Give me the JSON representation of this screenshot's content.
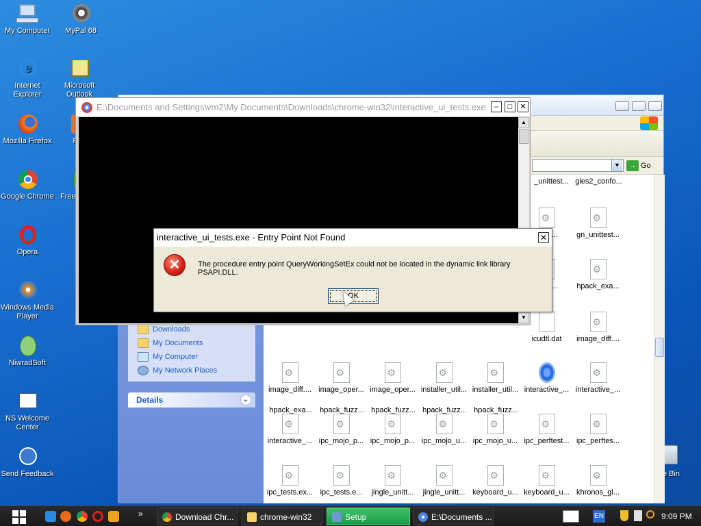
{
  "desktop": {
    "icons": [
      {
        "label": "My Computer"
      },
      {
        "label": "MyPal 68"
      },
      {
        "label": "Internet Explorer"
      },
      {
        "label": "Microsoft Outlook"
      },
      {
        "label": "Mozilla Firefox"
      },
      {
        "label": "P"
      },
      {
        "label": "Google Chrome"
      },
      {
        "label": "Free D Ma"
      },
      {
        "label": "Opera"
      },
      {
        "label": "Windows Media Player"
      },
      {
        "label": "NiwradSoft"
      },
      {
        "label": "NS Welcome Center"
      },
      {
        "label": "Send Feedback"
      }
    ],
    "recycle_label": "cle Bin"
  },
  "explorer": {
    "go_label": "Go",
    "tasks": [
      {
        "label": "Downloads"
      },
      {
        "label": "My Documents"
      },
      {
        "label": "My Computer"
      },
      {
        "label": "My Network Places"
      }
    ],
    "details_label": "Details",
    "files": [
      {
        "label": "_unittest...",
        "icon": "gear"
      },
      {
        "label": "gles2_confo...",
        "icon": "gear"
      },
      {
        "label": "...est...",
        "icon": "gear"
      },
      {
        "label": "gn_unittest...",
        "icon": "gear"
      },
      {
        "label": "...tes...",
        "icon": "gear"
      },
      {
        "label": "hpack_exa...",
        "icon": "gear"
      },
      {
        "label": "hpack_exa...",
        "icon": "gear"
      },
      {
        "label": "hpack_fuzz...",
        "icon": "gear"
      },
      {
        "label": "hpack_fuzz...",
        "icon": "gear"
      },
      {
        "label": "hpack_fuzz...",
        "icon": "gear"
      },
      {
        "label": "hpack_fuzz...",
        "icon": "gear"
      },
      {
        "label": "icudtl.dat",
        "icon": "blank"
      },
      {
        "label": "image_diff....",
        "icon": "gear"
      },
      {
        "label": "image_diff....",
        "icon": "gear"
      },
      {
        "label": "image_oper...",
        "icon": "gear"
      },
      {
        "label": "image_oper...",
        "icon": "gear"
      },
      {
        "label": "installer_util...",
        "icon": "gear"
      },
      {
        "label": "installer_util...",
        "icon": "gear"
      },
      {
        "label": "interactive_...",
        "icon": "chrome"
      },
      {
        "label": "interactive_...",
        "icon": "gear"
      },
      {
        "label": "interactive_...",
        "icon": "gear"
      },
      {
        "label": "ipc_mojo_p...",
        "icon": "gear"
      },
      {
        "label": "ipc_mojo_p...",
        "icon": "gear"
      },
      {
        "label": "ipc_mojo_u...",
        "icon": "gear"
      },
      {
        "label": "ipc_mojo_u...",
        "icon": "gear"
      },
      {
        "label": "ipc_perftest...",
        "icon": "gear"
      },
      {
        "label": "ipc_perftes...",
        "icon": "gear"
      },
      {
        "label": "ipc_tests.ex...",
        "icon": "gear"
      },
      {
        "label": "ipc_tests.e...",
        "icon": "gear"
      },
      {
        "label": "jingle_unitt...",
        "icon": "gear"
      },
      {
        "label": "jingle_unitt...",
        "icon": "gear"
      },
      {
        "label": "keyboard_u...",
        "icon": "gear"
      },
      {
        "label": "keyboard_u...",
        "icon": "gear"
      },
      {
        "label": "khronos_gl...",
        "icon": "gear"
      }
    ]
  },
  "console": {
    "title": "E:\\Documents and Settings\\vm2\\My Documents\\Downloads\\chrome-win32\\interactive_ui_tests.exe"
  },
  "dialog": {
    "title": "interactive_ui_tests.exe - Entry Point Not Found",
    "message": "The procedure entry point QueryWorkingSetEx could not be located in the dynamic link library PSAPI.DLL.",
    "ok_label": "OK"
  },
  "taskbar": {
    "tasks": [
      {
        "label": "Download Chr..."
      },
      {
        "label": "chrome-win32"
      },
      {
        "label": "Setup"
      },
      {
        "label": "E:\\Documents ..."
      }
    ],
    "overflow": "»",
    "lang": "EN",
    "clock": "9:09 PM"
  }
}
